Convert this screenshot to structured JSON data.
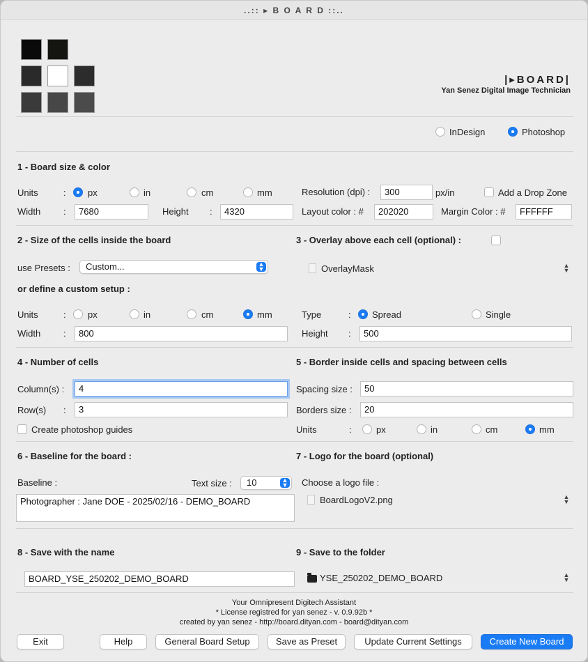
{
  "window": {
    "title": "..:: ▸ B O A R D ::.."
  },
  "brand": {
    "logo_text": "|▸BOARD|",
    "tagline": "Yan Senez Digital Image Technician"
  },
  "target": {
    "indesign": "InDesign",
    "photoshop": "Photoshop",
    "selected": "Photoshop"
  },
  "colors": {
    "accent": "#1a7cf5",
    "window_bg": "#ececec"
  },
  "logo_squares": [
    {
      "color": "#0a0a0a"
    },
    {
      "color": "#141410"
    },
    null,
    {
      "color": "#2a2a2a"
    },
    {
      "color": "#ffffff"
    },
    {
      "color": "#2c2c2c"
    },
    {
      "color": "#3a3a3a"
    },
    {
      "color": "#474747"
    },
    {
      "color": "#4b4b4b"
    }
  ],
  "s1": {
    "title": "1 - Board size & color",
    "units_label": "Units",
    "width_label": "Width",
    "height_label": "Height",
    "colon": ":",
    "unit_px": "px",
    "unit_in": "in",
    "unit_cm": "cm",
    "unit_mm": "mm",
    "unit_selected": "px",
    "width_value": "7680",
    "height_value": "4320",
    "resolution_label": "Resolution (dpi) :",
    "resolution_value": "300",
    "resolution_unit": "px/in",
    "drop_zone_label": "Add a Drop Zone",
    "layout_color_label": "Layout color : #",
    "layout_color_value": "202020",
    "margin_color_label": "Margin Color : #",
    "margin_color_value": "FFFFFF"
  },
  "s2": {
    "title": "2 - Size of the cells inside the board",
    "presets_label": "use Presets :",
    "presets_value": "Custom...",
    "custom_label": "or define a custom setup :",
    "units_label": "Units",
    "unit_selected": "mm",
    "width_label": "Width",
    "width_value": "800"
  },
  "s3": {
    "title": "3 - Overlay above each cell (optional) :",
    "overlay_file": "OverlayMask",
    "type_label": "Type",
    "type_spread": "Spread",
    "type_single": "Single",
    "type_selected": "Spread",
    "height_label": "Height",
    "height_value": "500"
  },
  "s4": {
    "title": "4 - Number of cells",
    "columns_label": "Column(s) :",
    "columns_value": "4",
    "rows_label": "Row(s)",
    "rows_value": "3",
    "guides_label": "Create photoshop guides"
  },
  "s5": {
    "title": "5 - Border inside cells and spacing between cells",
    "spacing_label": "Spacing size :",
    "spacing_value": "50",
    "borders_label": "Borders size :",
    "borders_value": "20",
    "units_label": "Units",
    "unit_selected": "mm"
  },
  "s6": {
    "title": "6 - Baseline for the board :",
    "baseline_label": "Baseline :",
    "text_size_label": "Text size :",
    "text_size_value": "10",
    "baseline_value": "Photographer : Jane DOE - 2025/02/16 - DEMO_BOARD"
  },
  "s7": {
    "title": "7 - Logo for the board (optional)",
    "choose_label": "Choose a logo file :",
    "logo_file": "BoardLogoV2.png"
  },
  "s8": {
    "title": "8 - Save with the name",
    "name_value": "BOARD_YSE_250202_DEMO_BOARD"
  },
  "s9": {
    "title": "9 - Save to the folder",
    "folder_value": "YSE_250202_DEMO_BOARD"
  },
  "footer": {
    "line1": "Your Omnipresent Digitech Assistant",
    "line2": "* License registred for yan senez - v. 0.9.92b *",
    "line3": "created by yan senez - http://board.dityan.com - board@dityan.com"
  },
  "buttons": {
    "exit": "Exit",
    "help": "Help",
    "general": "General Board Setup",
    "save_preset": "Save as Preset",
    "update": "Update Current Settings",
    "create": "Create New Board"
  }
}
